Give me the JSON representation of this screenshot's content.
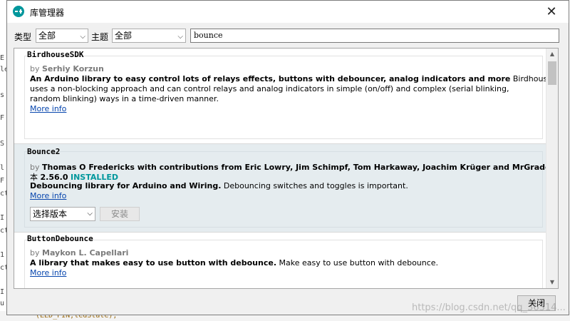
{
  "background": {
    "left_fragments": [
      "E",
      "le",
      "s",
      "F",
      "S",
      "l",
      "F",
      "ct",
      "I",
      "ct",
      "1",
      "ct",
      "I",
      "u"
    ],
    "bottom_code": "(LED_PIN,ledState);"
  },
  "window": {
    "title": "库管理器",
    "close_glyph": "✕"
  },
  "filters": {
    "type_label": "类型",
    "type_value": "全部",
    "topic_label": "主题",
    "topic_value": "全部",
    "search_value": "bounce"
  },
  "libraries": [
    {
      "name": "BirdhouseSDK",
      "by": "by",
      "author": "Serhiy Korzun",
      "summary_bold": "An Arduino library to easy control lots of relays effects, buttons with debouncer, analog indicators and more",
      "desc_lines": [
        "BirdhouseSDK",
        "uses a non-blocking approach and can control relays and analog indicators in simple (on/off) and complex (serial blinking,",
        "random blinking) ways in a time-driven manner."
      ],
      "more_info": "More info"
    },
    {
      "name": "Bounce2",
      "by": "by",
      "authors_line": "Thomas O Fredericks  with contributions from Eric Lowry, Jim Schimpf, Tom Harkaway, Joachim Krüger and MrGradgrind.",
      "version_prefix": "版",
      "version_prefix2": "本",
      "version": "2.56.0",
      "installed": "INSTALLED",
      "summary_bold": "Debouncing library for Arduino and Wiring.",
      "desc": "Debouncing switches and toggles is important.",
      "more_info": "More info",
      "version_select": "选择版本",
      "install_button": "安装"
    },
    {
      "name": "ButtonDebounce",
      "by": "by",
      "author": "Maykon L. Capellari",
      "summary_bold": "A library that makes easy to use button with debounce.",
      "desc": "Make easy to use button with debounce.",
      "more_info": "More info"
    }
  ],
  "footer": {
    "close_button": "关闭",
    "watermark": "https://blog.csdn.net/qq_36314..."
  },
  "colors": {
    "accent": "#00979c",
    "link": "#0645ad",
    "selected_bg": "#e5ecef"
  }
}
